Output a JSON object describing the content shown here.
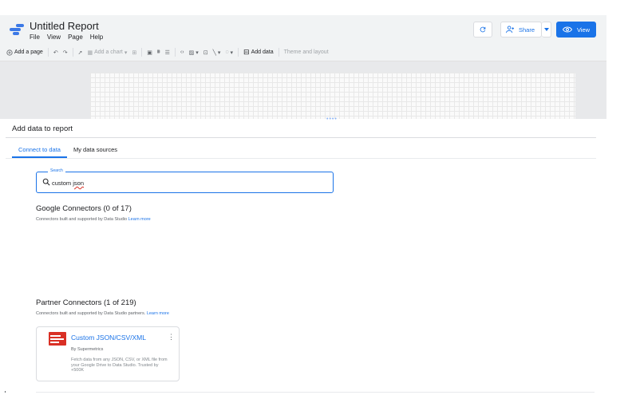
{
  "header": {
    "title": "Untitled Report",
    "menu": [
      "File",
      "View",
      "Page",
      "Help"
    ],
    "share_label": "Share",
    "view_label": "View",
    "accent": "#1a73e8"
  },
  "toolbar": {
    "add_page": "Add a page",
    "add_chart": "Add a chart",
    "add_data": "Add data",
    "theme_layout": "Theme and layout"
  },
  "panel": {
    "title": "Add data to report",
    "tabs": [
      {
        "label": "Connect to data",
        "active": true
      },
      {
        "label": "My data sources",
        "active": false
      }
    ],
    "search": {
      "label": "Search",
      "value_prefix": "custom ",
      "value_misspelled": "json"
    },
    "google": {
      "title": "Google Connectors (0 of 17)",
      "subtitle": "Connectors built and supported by Data Studio",
      "link": "Learn more"
    },
    "partner": {
      "title": "Partner Connectors (1 of 219)",
      "subtitle": "Connectors built and supported by Data Studio partners.",
      "link": "Learn more"
    },
    "card": {
      "name": "Custom JSON/CSV/XML",
      "by": "By Supermetrics",
      "description": "Fetch data from any JSON, CSV, or XML file from your Google Drive to Data Studio. Trusted by +500K",
      "logo_color": "#d93025"
    }
  },
  "icons": {
    "refresh": "refresh-icon",
    "share": "person-add-icon",
    "view": "eye-icon",
    "search": "search-icon",
    "more": "more-vert-icon"
  }
}
